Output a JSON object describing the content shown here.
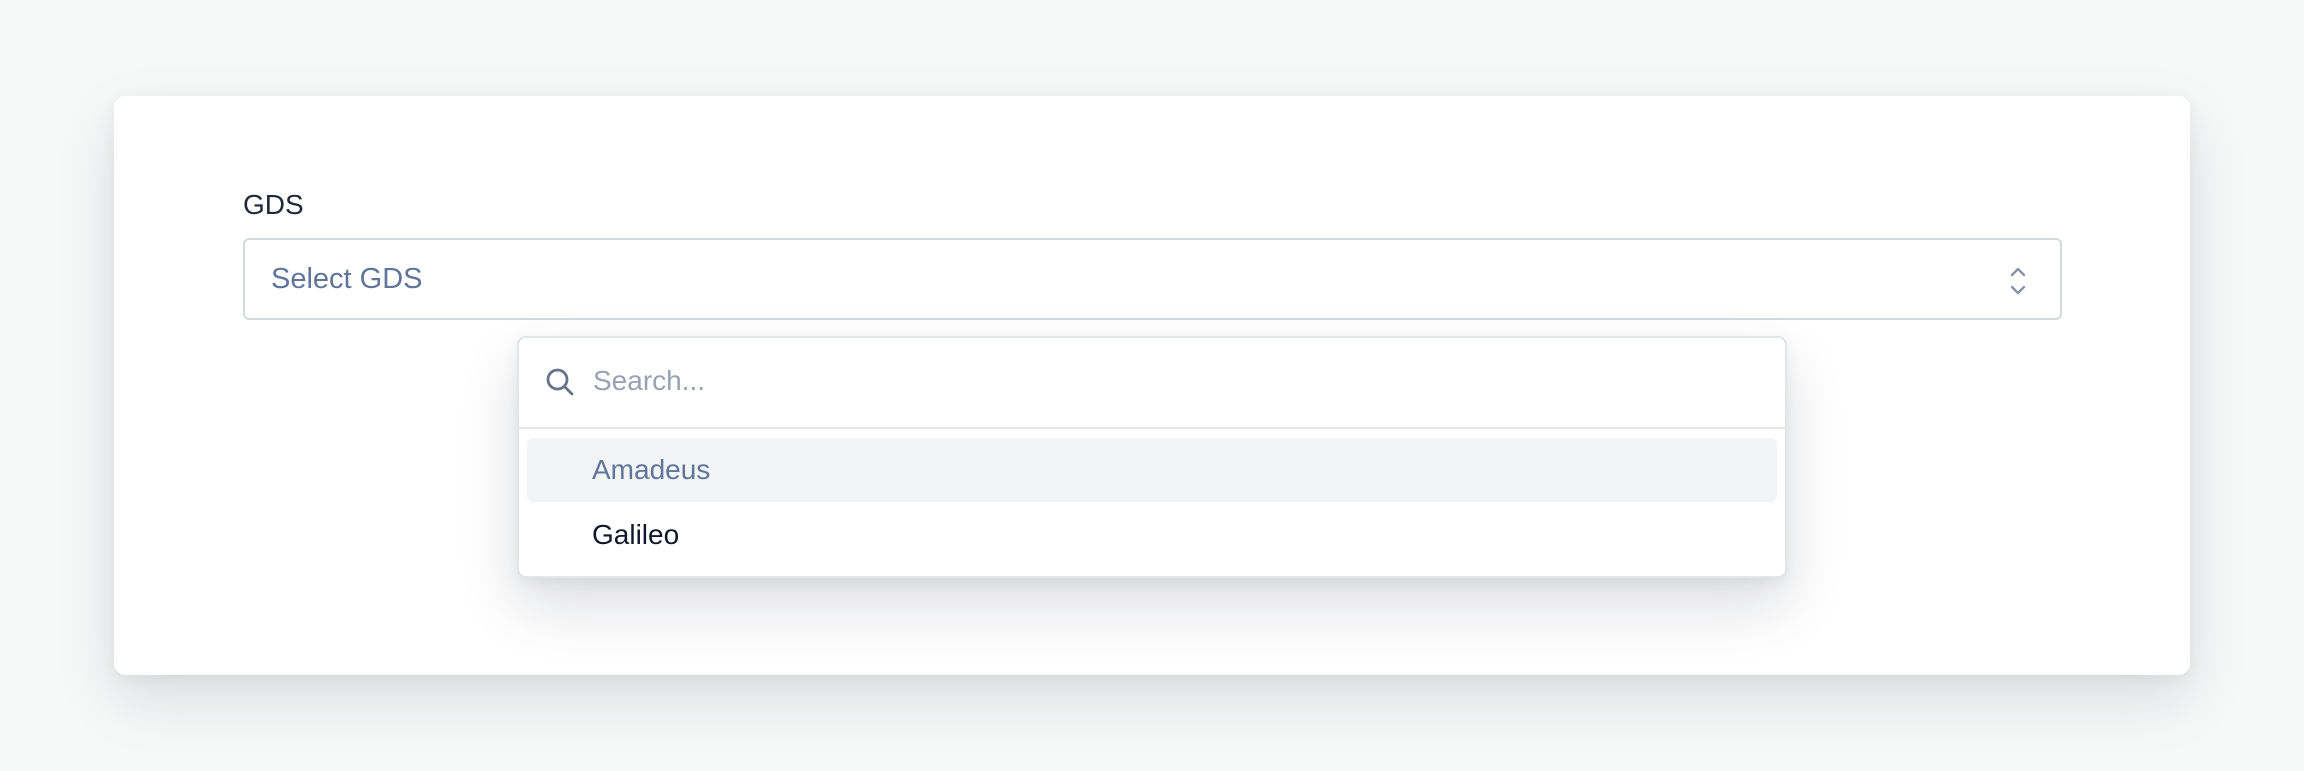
{
  "form": {
    "label": "GDS",
    "select": {
      "placeholder": "Select GDS"
    }
  },
  "dropdown": {
    "search_placeholder": "Search...",
    "options": [
      {
        "label": "Amadeus",
        "highlighted": true
      },
      {
        "label": "Galileo",
        "highlighted": false
      }
    ]
  },
  "icons": {
    "select": "chevron-up-down-icon",
    "search": "search-icon"
  },
  "colors": {
    "label_text": "#1e293b",
    "placeholder_text": "#60759a",
    "option_text": "#0f172a",
    "highlight_bg": "#f3f4f6"
  }
}
